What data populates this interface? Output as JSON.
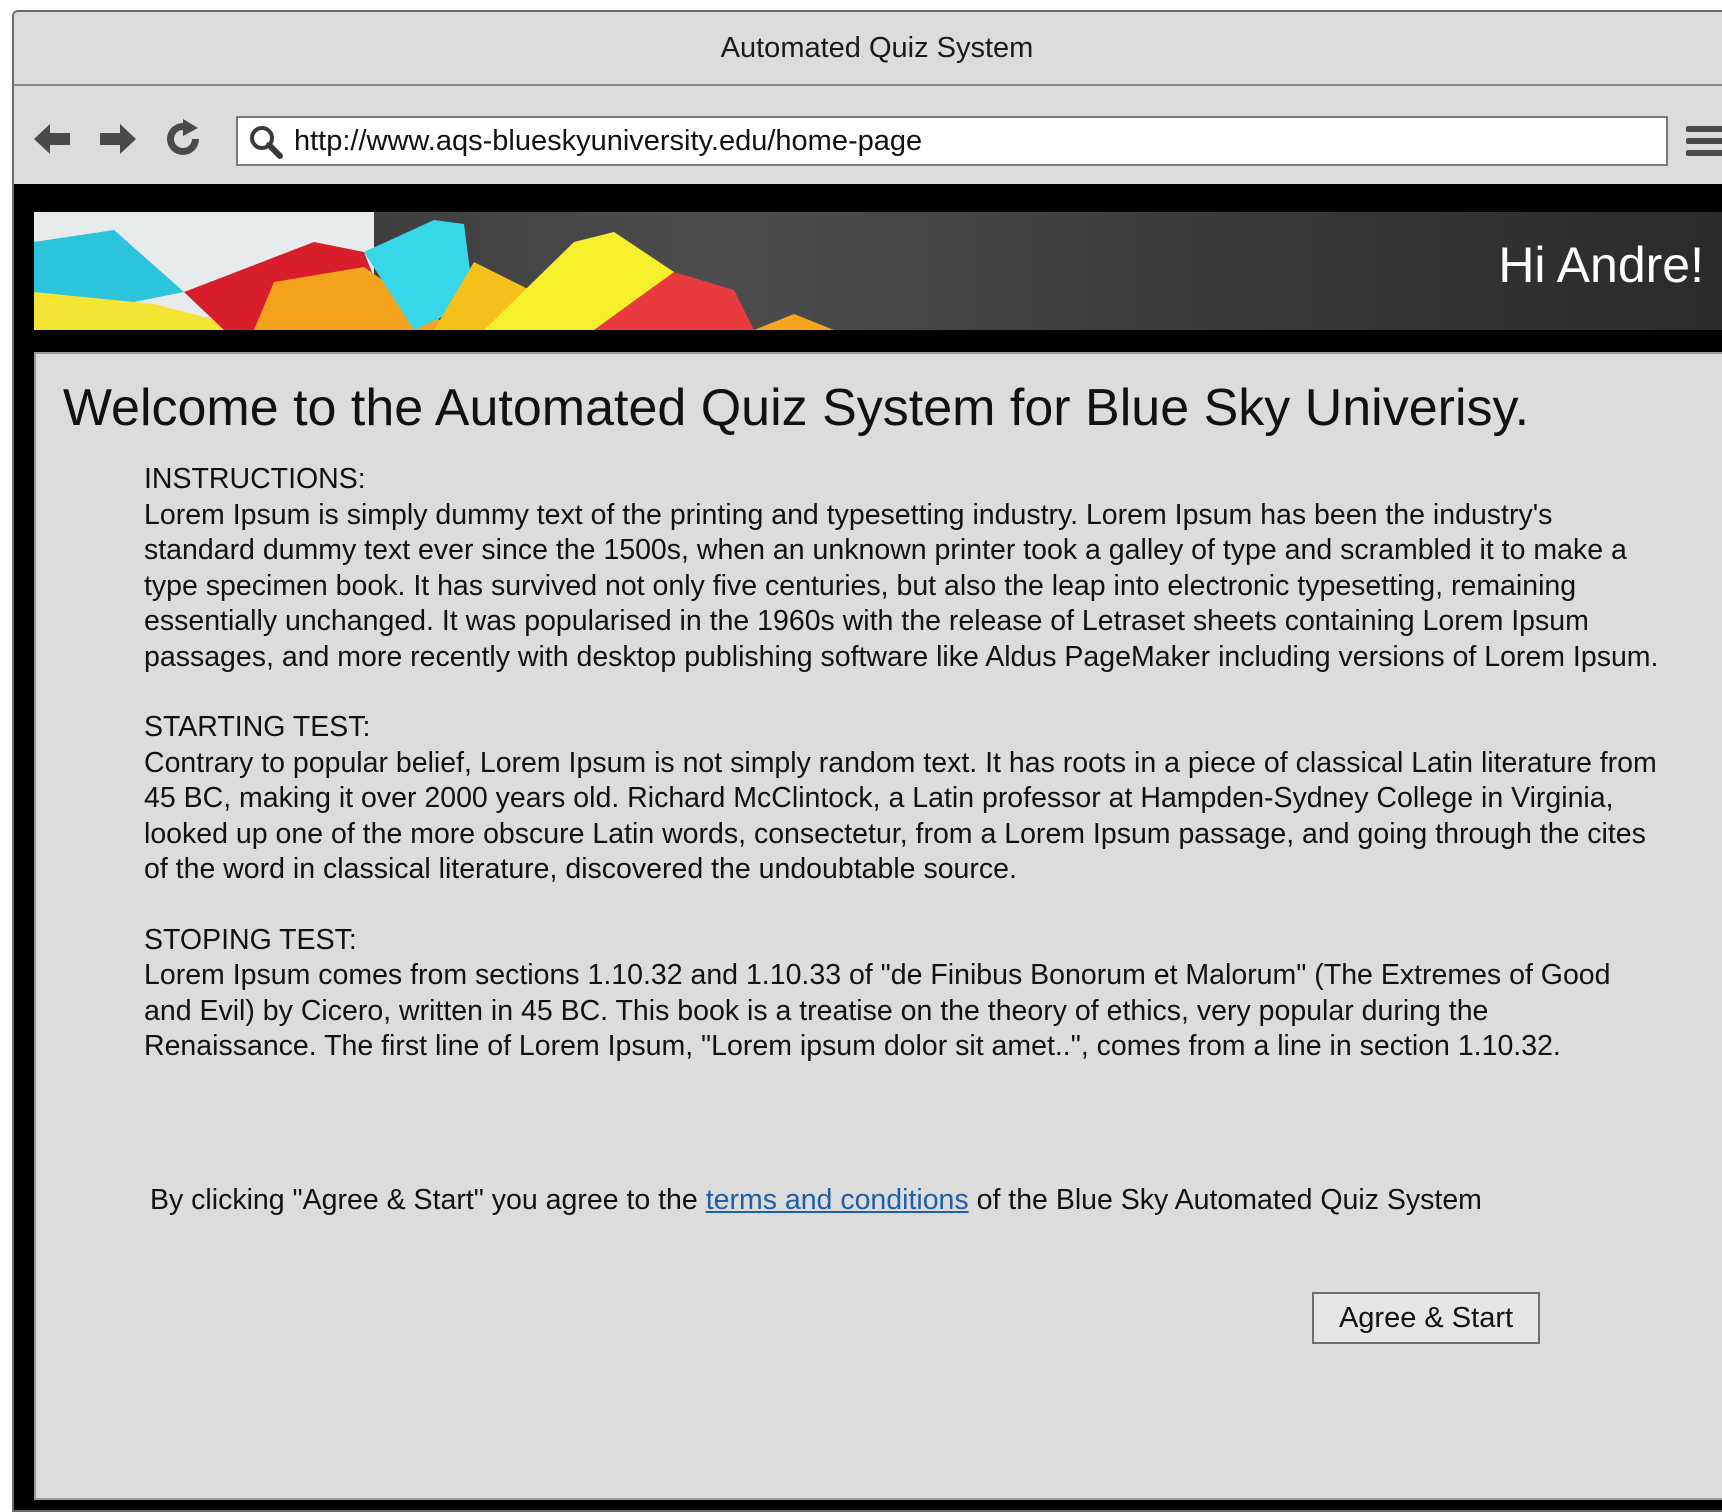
{
  "window": {
    "title": "Automated Quiz System"
  },
  "browser": {
    "back_icon": "arrow-left-icon",
    "forward_icon": "arrow-right-icon",
    "reload_icon": "reload-icon",
    "menu_icon": "hamburger-menu-icon",
    "url": "http://www.aqs-blueskyuniversity.edu/home-page"
  },
  "header": {
    "greeting": "Hi Andre!"
  },
  "main": {
    "title": "Welcome to the Automated Quiz System for Blue Sky Univerisy.",
    "sections": [
      {
        "heading": "INSTRUCTIONS:",
        "body": "Lorem Ipsum is simply dummy text of the printing and typesetting industry. Lorem Ipsum has been the industry's standard dummy text ever since the 1500s, when an unknown printer took a galley of type and scrambled it to make a type specimen book. It has survived not only five centuries, but also the leap into electronic typesetting, remaining essentially unchanged. It was popularised in the 1960s with the release of Letraset sheets containing Lorem Ipsum passages, and more recently with desktop publishing software like Aldus PageMaker including versions of Lorem Ipsum."
      },
      {
        "heading": "STARTING TEST:",
        "body": "Contrary to popular belief, Lorem Ipsum is not simply random text. It has roots in a piece of classical Latin literature from 45 BC, making it over 2000 years old. Richard McClintock, a Latin professor at Hampden-Sydney College in Virginia, looked up one of the more obscure Latin words, consectetur, from a Lorem Ipsum passage, and going through the cites of the word in classical literature, discovered the undoubtable source."
      },
      {
        "heading": "STOPING TEST:",
        "body": "Lorem Ipsum comes from sections 1.10.32 and 1.10.33 of \"de Finibus Bonorum et Malorum\" (The Extremes of Good and Evil) by Cicero, written in 45 BC. This book is a treatise on the theory of ethics, very popular during the Renaissance. The first line of Lorem Ipsum, \"Lorem ipsum dolor sit amet..\", comes from a line in section 1.10.32."
      }
    ],
    "agreement": {
      "prefix": "By clicking \"Agree & Start\" you agree to the ",
      "link_text": "terms and conditions",
      "suffix": " of the Blue Sky Automated Quiz System"
    },
    "start_button_label": "Agree & Start"
  },
  "colors": {
    "page_bg": "#dcdcdc",
    "frame_bg": "#000000",
    "link": "#1f5fa8",
    "greeting_text": "#ffffff"
  }
}
